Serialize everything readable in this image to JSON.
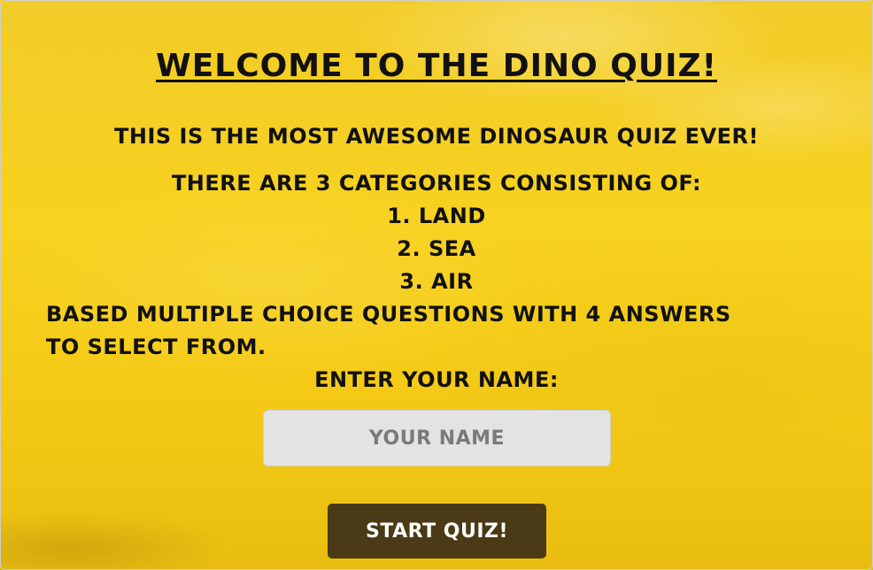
{
  "page": {
    "title": "Welcome to the Dino Quiz!",
    "intro": "This is the most awesome dinosaur quiz ever!",
    "categories_heading": "There are 3 categories consisting of:",
    "categories": [
      "1. Land",
      "2. Sea",
      "3. Air"
    ],
    "description": "based multiple choice questions with 4 answers to select from.",
    "name_label": "Enter your name:"
  },
  "form": {
    "name_placeholder": "Your name",
    "name_value": "",
    "start_label": "Start Quiz!"
  },
  "colors": {
    "background": "#f5c91f",
    "input_background": "#e3e3e3",
    "button_background": "#4a3a16",
    "button_text": "#ffffff",
    "text": "#111111"
  }
}
